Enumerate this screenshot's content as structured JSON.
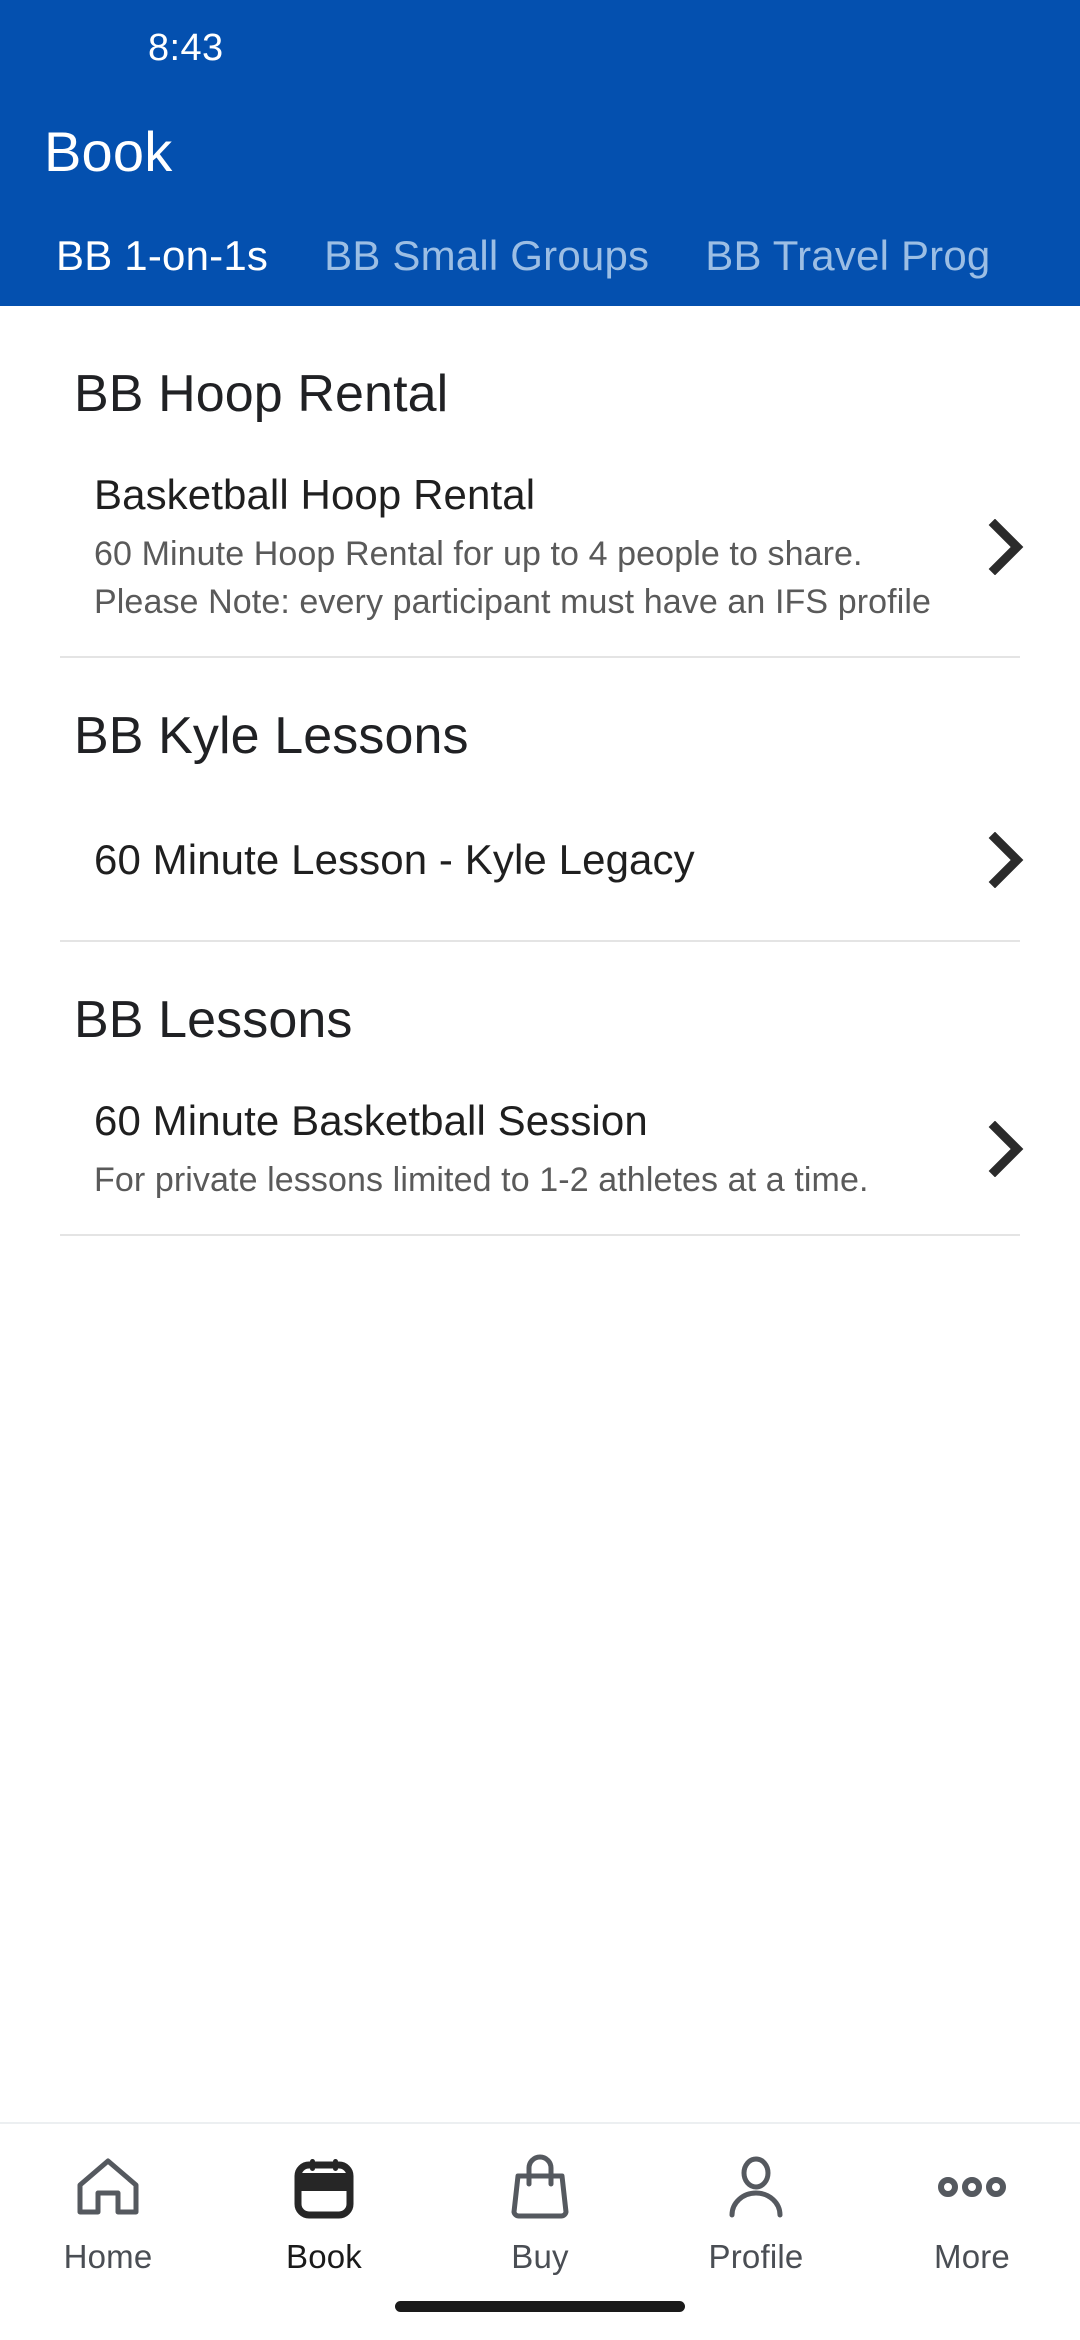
{
  "status_bar": {
    "time": "8:43"
  },
  "header": {
    "title": "Book",
    "background_color": "#0450AF",
    "active_tab_color": "#FFFFFF",
    "inactive_tab_color": "#9CBEE4",
    "tabs": [
      {
        "label": "BB 1-on-1s",
        "active": true
      },
      {
        "label": "BB Small Groups",
        "active": false
      },
      {
        "label": "BB Travel Prog",
        "active": false
      }
    ]
  },
  "content": {
    "sections": [
      {
        "title": "BB Hoop Rental",
        "items": [
          {
            "title": "Basketball Hoop Rental",
            "description": "60 Minute Hoop Rental for up to 4 people to share. Please Note: every participant must have an IFS profile",
            "chevron": "chevron-right-icon"
          }
        ]
      },
      {
        "title": "BB Kyle Lessons",
        "items": [
          {
            "title": "60 Minute Lesson - Kyle Legacy",
            "description": "",
            "chevron": "chevron-right-icon"
          }
        ]
      },
      {
        "title": "BB Lessons",
        "items": [
          {
            "title": "60 Minute Basketball Session",
            "description": "For private lessons limited to 1-2 athletes at a time.",
            "chevron": "chevron-right-icon"
          }
        ]
      }
    ]
  },
  "bottom_nav": {
    "items": [
      {
        "label": "Home",
        "icon": "home-icon",
        "active": false
      },
      {
        "label": "Book",
        "icon": "calendar-icon",
        "active": true
      },
      {
        "label": "Buy",
        "icon": "bag-icon",
        "active": false
      },
      {
        "label": "Profile",
        "icon": "person-icon",
        "active": false
      },
      {
        "label": "More",
        "icon": "ellipsis-icon",
        "active": false
      }
    ]
  }
}
